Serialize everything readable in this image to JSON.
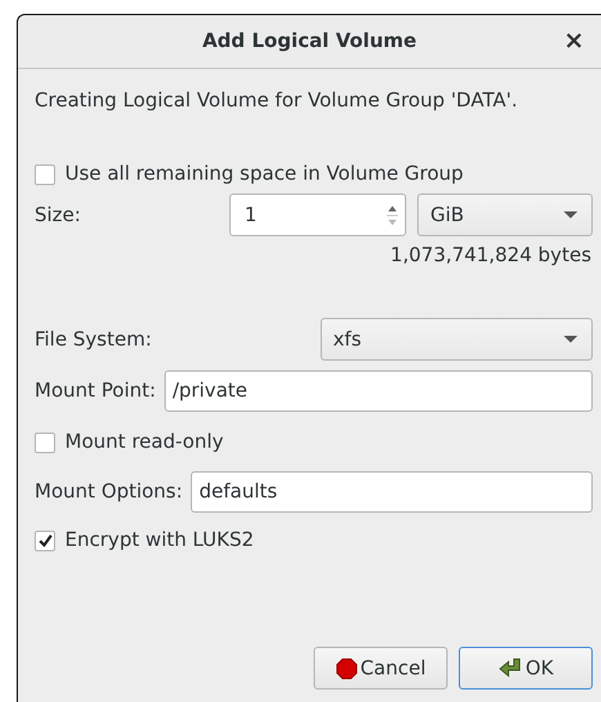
{
  "window": {
    "title": "Add Logical Volume",
    "close": "×"
  },
  "description": "Creating Logical Volume for Volume Group 'DATA'.",
  "use_all": {
    "label": "Use all remaining space in Volume Group",
    "checked": false
  },
  "size": {
    "label": "Size:",
    "value": "1",
    "unit": "GiB",
    "bytes": "1,073,741,824 bytes"
  },
  "file_system": {
    "label": "File System:",
    "value": "xfs"
  },
  "mount_point": {
    "label": "Mount Point:",
    "value": "/private"
  },
  "read_only": {
    "label": "Mount read-only",
    "checked": false
  },
  "mount_options": {
    "label": "Mount Options:",
    "value": "defaults"
  },
  "encrypt": {
    "label": "Encrypt with LUKS2",
    "checked": true
  },
  "buttons": [
    {
      "kind": "cancel",
      "label": "Cancel"
    },
    {
      "kind": "ok",
      "label": "OK"
    }
  ]
}
